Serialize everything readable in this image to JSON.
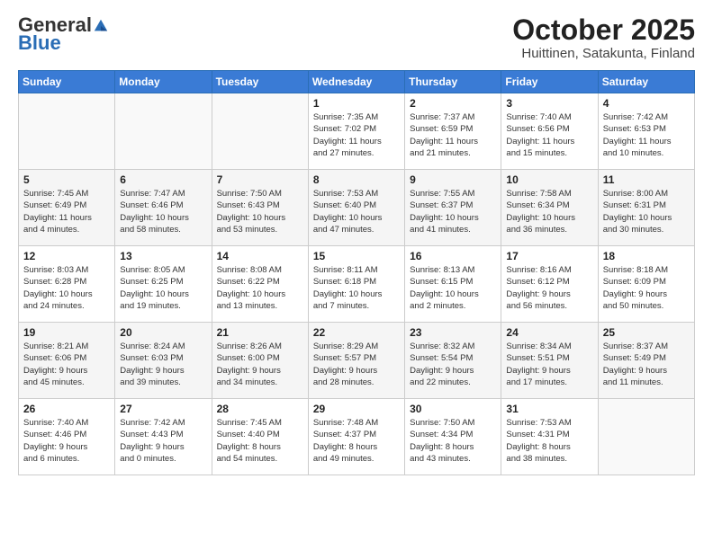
{
  "header": {
    "logo_general": "General",
    "logo_blue": "Blue",
    "title": "October 2025",
    "subtitle": "Huittinen, Satakunta, Finland"
  },
  "days_of_week": [
    "Sunday",
    "Monday",
    "Tuesday",
    "Wednesday",
    "Thursday",
    "Friday",
    "Saturday"
  ],
  "weeks": [
    [
      {
        "day": "",
        "info": ""
      },
      {
        "day": "",
        "info": ""
      },
      {
        "day": "",
        "info": ""
      },
      {
        "day": "1",
        "info": "Sunrise: 7:35 AM\nSunset: 7:02 PM\nDaylight: 11 hours\nand 27 minutes."
      },
      {
        "day": "2",
        "info": "Sunrise: 7:37 AM\nSunset: 6:59 PM\nDaylight: 11 hours\nand 21 minutes."
      },
      {
        "day": "3",
        "info": "Sunrise: 7:40 AM\nSunset: 6:56 PM\nDaylight: 11 hours\nand 15 minutes."
      },
      {
        "day": "4",
        "info": "Sunrise: 7:42 AM\nSunset: 6:53 PM\nDaylight: 11 hours\nand 10 minutes."
      }
    ],
    [
      {
        "day": "5",
        "info": "Sunrise: 7:45 AM\nSunset: 6:49 PM\nDaylight: 11 hours\nand 4 minutes."
      },
      {
        "day": "6",
        "info": "Sunrise: 7:47 AM\nSunset: 6:46 PM\nDaylight: 10 hours\nand 58 minutes."
      },
      {
        "day": "7",
        "info": "Sunrise: 7:50 AM\nSunset: 6:43 PM\nDaylight: 10 hours\nand 53 minutes."
      },
      {
        "day": "8",
        "info": "Sunrise: 7:53 AM\nSunset: 6:40 PM\nDaylight: 10 hours\nand 47 minutes."
      },
      {
        "day": "9",
        "info": "Sunrise: 7:55 AM\nSunset: 6:37 PM\nDaylight: 10 hours\nand 41 minutes."
      },
      {
        "day": "10",
        "info": "Sunrise: 7:58 AM\nSunset: 6:34 PM\nDaylight: 10 hours\nand 36 minutes."
      },
      {
        "day": "11",
        "info": "Sunrise: 8:00 AM\nSunset: 6:31 PM\nDaylight: 10 hours\nand 30 minutes."
      }
    ],
    [
      {
        "day": "12",
        "info": "Sunrise: 8:03 AM\nSunset: 6:28 PM\nDaylight: 10 hours\nand 24 minutes."
      },
      {
        "day": "13",
        "info": "Sunrise: 8:05 AM\nSunset: 6:25 PM\nDaylight: 10 hours\nand 19 minutes."
      },
      {
        "day": "14",
        "info": "Sunrise: 8:08 AM\nSunset: 6:22 PM\nDaylight: 10 hours\nand 13 minutes."
      },
      {
        "day": "15",
        "info": "Sunrise: 8:11 AM\nSunset: 6:18 PM\nDaylight: 10 hours\nand 7 minutes."
      },
      {
        "day": "16",
        "info": "Sunrise: 8:13 AM\nSunset: 6:15 PM\nDaylight: 10 hours\nand 2 minutes."
      },
      {
        "day": "17",
        "info": "Sunrise: 8:16 AM\nSunset: 6:12 PM\nDaylight: 9 hours\nand 56 minutes."
      },
      {
        "day": "18",
        "info": "Sunrise: 8:18 AM\nSunset: 6:09 PM\nDaylight: 9 hours\nand 50 minutes."
      }
    ],
    [
      {
        "day": "19",
        "info": "Sunrise: 8:21 AM\nSunset: 6:06 PM\nDaylight: 9 hours\nand 45 minutes."
      },
      {
        "day": "20",
        "info": "Sunrise: 8:24 AM\nSunset: 6:03 PM\nDaylight: 9 hours\nand 39 minutes."
      },
      {
        "day": "21",
        "info": "Sunrise: 8:26 AM\nSunset: 6:00 PM\nDaylight: 9 hours\nand 34 minutes."
      },
      {
        "day": "22",
        "info": "Sunrise: 8:29 AM\nSunset: 5:57 PM\nDaylight: 9 hours\nand 28 minutes."
      },
      {
        "day": "23",
        "info": "Sunrise: 8:32 AM\nSunset: 5:54 PM\nDaylight: 9 hours\nand 22 minutes."
      },
      {
        "day": "24",
        "info": "Sunrise: 8:34 AM\nSunset: 5:51 PM\nDaylight: 9 hours\nand 17 minutes."
      },
      {
        "day": "25",
        "info": "Sunrise: 8:37 AM\nSunset: 5:49 PM\nDaylight: 9 hours\nand 11 minutes."
      }
    ],
    [
      {
        "day": "26",
        "info": "Sunrise: 7:40 AM\nSunset: 4:46 PM\nDaylight: 9 hours\nand 6 minutes."
      },
      {
        "day": "27",
        "info": "Sunrise: 7:42 AM\nSunset: 4:43 PM\nDaylight: 9 hours\nand 0 minutes."
      },
      {
        "day": "28",
        "info": "Sunrise: 7:45 AM\nSunset: 4:40 PM\nDaylight: 8 hours\nand 54 minutes."
      },
      {
        "day": "29",
        "info": "Sunrise: 7:48 AM\nSunset: 4:37 PM\nDaylight: 8 hours\nand 49 minutes."
      },
      {
        "day": "30",
        "info": "Sunrise: 7:50 AM\nSunset: 4:34 PM\nDaylight: 8 hours\nand 43 minutes."
      },
      {
        "day": "31",
        "info": "Sunrise: 7:53 AM\nSunset: 4:31 PM\nDaylight: 8 hours\nand 38 minutes."
      },
      {
        "day": "",
        "info": ""
      }
    ]
  ]
}
